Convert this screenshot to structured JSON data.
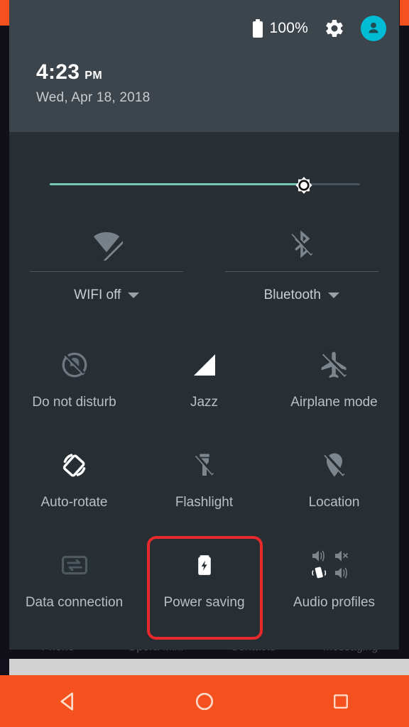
{
  "status_bar": {
    "battery_percent": "100%",
    "battery_icon": "battery-full-icon",
    "settings_icon": "gear-icon",
    "avatar_icon": "user-avatar-icon",
    "avatar_color": "#00bcd4"
  },
  "clock": {
    "time": "4:23",
    "ampm": "PM",
    "date": "Wed, Apr 18, 2018"
  },
  "brightness": {
    "label": "brightness-slider",
    "value_percent": 82,
    "fill_color": "#79c8b6",
    "track_color": "#4a545c",
    "thumb_icon": "brightness-sun-icon"
  },
  "connectivity": [
    {
      "label": "WIFI off",
      "icon": "wifi-off-icon",
      "active": false,
      "has_caret": true
    },
    {
      "label": "Bluetooth",
      "icon": "bluetooth-off-icon",
      "active": false,
      "has_caret": true
    }
  ],
  "tiles": [
    [
      {
        "label": "Do not disturb",
        "icon": "do-not-disturb-icon",
        "active": false
      },
      {
        "label": "Jazz",
        "icon": "signal-bars-icon",
        "active": true
      },
      {
        "label": "Airplane mode",
        "icon": "airplane-off-icon",
        "active": false
      }
    ],
    [
      {
        "label": "Auto-rotate",
        "icon": "auto-rotate-icon",
        "active": true
      },
      {
        "label": "Flashlight",
        "icon": "flashlight-off-icon",
        "active": false
      },
      {
        "label": "Location",
        "icon": "location-off-icon",
        "active": false
      }
    ],
    [
      {
        "label": "Data connection",
        "icon": "data-connection-icon",
        "active": false
      },
      {
        "label": "Power saving",
        "icon": "battery-saver-icon",
        "active": true
      },
      {
        "label": "Audio profiles",
        "icon": "audio-profiles-icon",
        "active": false
      }
    ]
  ],
  "highlight": {
    "target_label": "Power saving",
    "color": "#e8292c"
  },
  "dock": {
    "labels": [
      "Phone",
      "Opera Mini",
      "Contacts",
      "Messaging"
    ]
  },
  "nav_bar": {
    "color": "#f4511e",
    "buttons": [
      {
        "name": "back-button",
        "icon": "back-triangle-icon"
      },
      {
        "name": "home-button",
        "icon": "home-circle-icon"
      },
      {
        "name": "recents-button",
        "icon": "recents-square-icon"
      }
    ]
  },
  "theme": {
    "panel_bg": "#272f35",
    "header_bg": "#3c444c",
    "accent": "#00bcd4",
    "icon_active": "#ffffff",
    "icon_inactive": "#7d868d"
  }
}
